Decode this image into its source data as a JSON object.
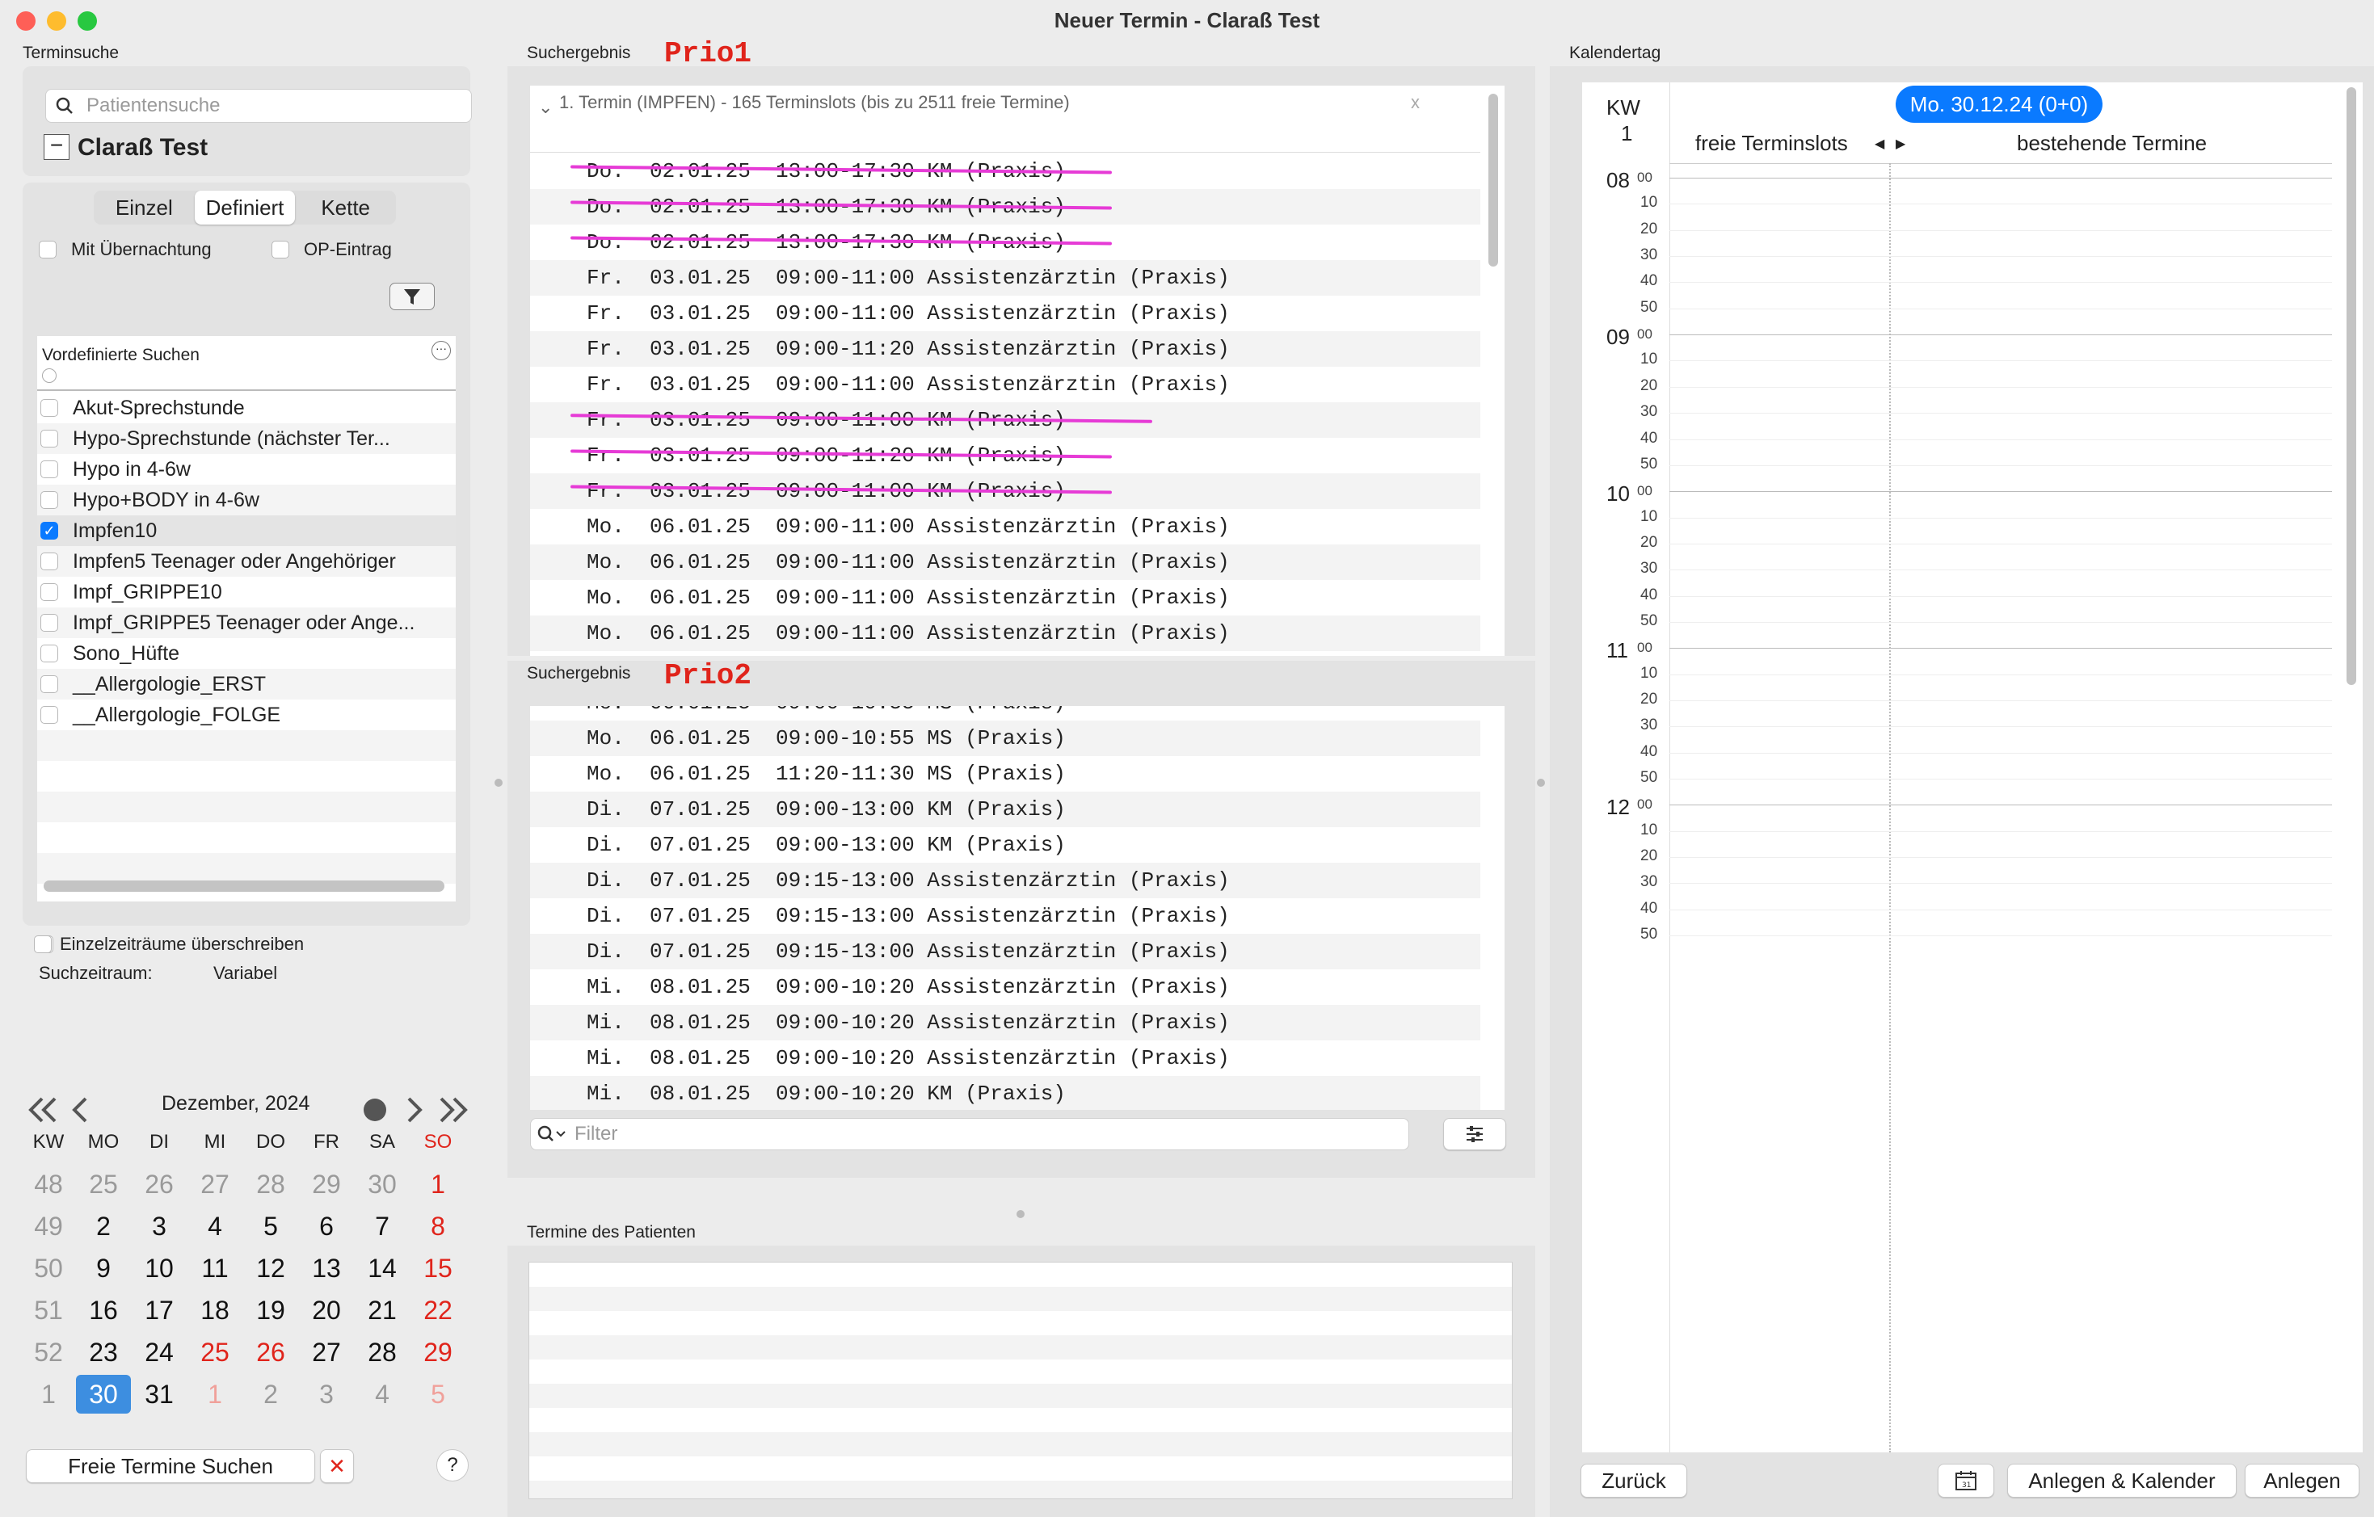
{
  "window": {
    "title": "Neuer Termin  - Claraß Test"
  },
  "left": {
    "section_label": "Terminsuche",
    "search_placeholder": "Patientensuche",
    "patient_name": "Claraß Test",
    "collapse_symbol": "−",
    "tabs": [
      "Einzel",
      "Definiert",
      "Kette"
    ],
    "selected_tab": "Definiert",
    "option_overnight": "Mit Übernachtung",
    "option_op": "OP-Eintrag",
    "predefined_header": "Vordefinierte Suchen",
    "predefined_items": [
      {
        "label": "Akut-Sprechstunde",
        "checked": false
      },
      {
        "label": "Hypo-Sprechstunde (nächster Ter...",
        "checked": false
      },
      {
        "label": "Hypo in 4-6w",
        "checked": false
      },
      {
        "label": "Hypo+BODY in 4-6w",
        "checked": false
      },
      {
        "label": "Impfen10",
        "checked": true
      },
      {
        "label": "Impfen5 Teenager oder Angehöriger",
        "checked": false
      },
      {
        "label": "Impf_GRIPPE10",
        "checked": false
      },
      {
        "label": "Impf_GRIPPE5 Teenager oder Ange...",
        "checked": false
      },
      {
        "label": "Sono_Hüfte",
        "checked": false
      },
      {
        "label": "__Allergologie_ERST",
        "checked": false
      },
      {
        "label": "__Allergologie_FOLGE",
        "checked": false
      }
    ],
    "override_label": "Einzelzeiträume überschreiben",
    "period_label": "Suchzeitraum:",
    "period_value": "Variabel"
  },
  "calendar": {
    "month": "Dezember, 2024",
    "headers": [
      "KW",
      "MO",
      "DI",
      "MI",
      "DO",
      "FR",
      "SA",
      "SO"
    ],
    "weeks": [
      {
        "kw": "48",
        "days": [
          "25",
          "26",
          "27",
          "28",
          "29",
          "30",
          "1"
        ]
      },
      {
        "kw": "49",
        "days": [
          "2",
          "3",
          "4",
          "5",
          "6",
          "7",
          "8"
        ]
      },
      {
        "kw": "50",
        "days": [
          "9",
          "10",
          "11",
          "12",
          "13",
          "14",
          "15"
        ]
      },
      {
        "kw": "51",
        "days": [
          "16",
          "17",
          "18",
          "19",
          "20",
          "21",
          "22"
        ]
      },
      {
        "kw": "52",
        "days": [
          "23",
          "24",
          "25",
          "26",
          "27",
          "28",
          "29"
        ]
      },
      {
        "kw": "1",
        "days": [
          "30",
          "31",
          "1",
          "2",
          "3",
          "4",
          "5"
        ]
      }
    ],
    "selected": "30",
    "colors": {
      "holiday": "#e0241b",
      "muted": "#9a9a9a",
      "selected_bg": "#3d8ee0"
    }
  },
  "buttons": {
    "search": "Freie Termine Suchen",
    "clear": "✕",
    "help": "?",
    "back": "Zurück",
    "create_calendar": "Anlegen & Kalender",
    "create": "Anlegen"
  },
  "results1": {
    "label": "Suchergebnis",
    "annotation": "Prio1",
    "header": "1. Termin (IMPFEN) - 165 Terminslots (bis zu 2511 freie Termine)",
    "close": "x",
    "rows": [
      {
        "text": "Do.  02.01.25  13:00-17:30 KM (Praxis)",
        "struck": true
      },
      {
        "text": "Do.  02.01.25  13:00-17:30 KM (Praxis)",
        "struck": true
      },
      {
        "text": "Do.  02.01.25  13:00-17:30 KM (Praxis)",
        "struck": true
      },
      {
        "text": "Fr.  03.01.25  09:00-11:00 Assistenzärztin (Praxis)",
        "struck": false
      },
      {
        "text": "Fr.  03.01.25  09:00-11:00 Assistenzärztin (Praxis)",
        "struck": false
      },
      {
        "text": "Fr.  03.01.25  09:00-11:20 Assistenzärztin (Praxis)",
        "struck": false
      },
      {
        "text": "Fr.  03.01.25  09:00-11:00 Assistenzärztin (Praxis)",
        "struck": false
      },
      {
        "text": "Fr.  03.01.25  09:00-11:00 KM (Praxis)",
        "struck": true
      },
      {
        "text": "Fr.  03.01.25  09:00-11:20 KM (Praxis)",
        "struck": true
      },
      {
        "text": "Fr.  03.01.25  09:00-11:00 KM (Praxis)",
        "struck": true
      },
      {
        "text": "Mo.  06.01.25  09:00-11:00 Assistenzärztin (Praxis)",
        "struck": false
      },
      {
        "text": "Mo.  06.01.25  09:00-11:00 Assistenzärztin (Praxis)",
        "struck": false
      },
      {
        "text": "Mo.  06.01.25  09:00-11:00 Assistenzärztin (Praxis)",
        "struck": false
      },
      {
        "text": "Mo.  06.01.25  09:00-11:00 Assistenzärztin (Praxis)",
        "struck": false
      }
    ]
  },
  "results2": {
    "label": "Suchergebnis",
    "annotation": "Prio2",
    "partial_row": "Mo.  06.01.25  09:00-10:55 MS (Praxis)",
    "rows": [
      "Mo.  06.01.25  09:00-10:55 MS (Praxis)",
      "Mo.  06.01.25  11:20-11:30 MS (Praxis)",
      "Di.  07.01.25  09:00-13:00 KM (Praxis)",
      "Di.  07.01.25  09:00-13:00 KM (Praxis)",
      "Di.  07.01.25  09:15-13:00 Assistenzärztin (Praxis)",
      "Di.  07.01.25  09:15-13:00 Assistenzärztin (Praxis)",
      "Di.  07.01.25  09:15-13:00 Assistenzärztin (Praxis)",
      "Mi.  08.01.25  09:00-10:20 Assistenzärztin (Praxis)",
      "Mi.  08.01.25  09:00-10:20 Assistenzärztin (Praxis)",
      "Mi.  08.01.25  09:00-10:20 Assistenzärztin (Praxis)",
      "Mi.  08.01.25  09:00-10:20 KM (Praxis)"
    ],
    "filter_placeholder": "Filter"
  },
  "patient_appts": {
    "label": "Termine des Patienten"
  },
  "day": {
    "label": "Kalendertag",
    "kw_label": "KW",
    "kw_value": "1",
    "date_badge": "Mo. 30.12.24 (0+0)",
    "col_free": "freie Terminslots",
    "col_existing": "bestehende Termine",
    "hours": [
      "08",
      "09",
      "10",
      "11",
      "12"
    ],
    "minute_suffix": "00",
    "minutes": [
      "10",
      "20",
      "30",
      "40",
      "50"
    ]
  }
}
